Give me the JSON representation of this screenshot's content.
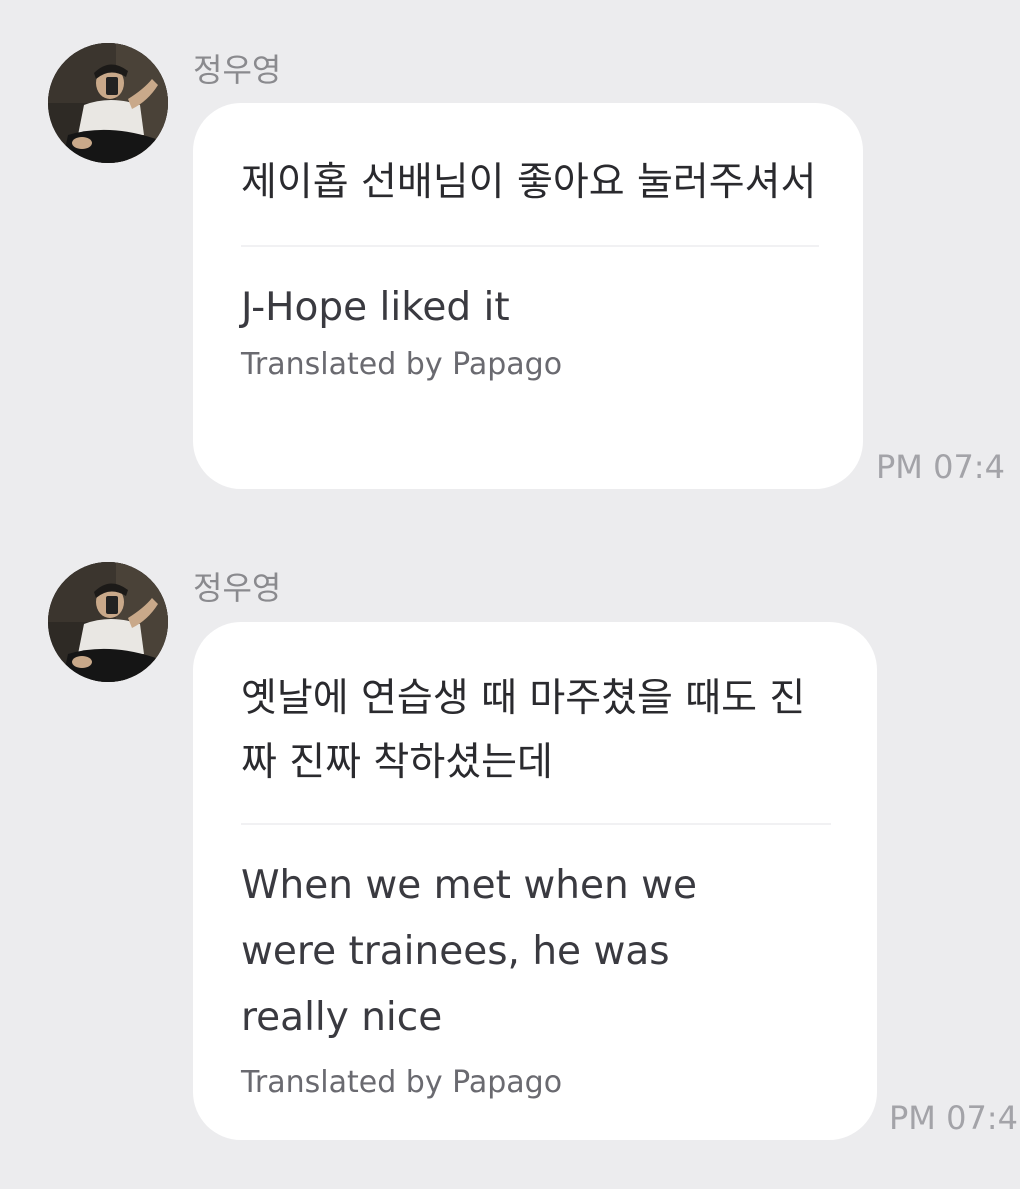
{
  "messages": [
    {
      "sender": "정우영",
      "original": "제이홉 선배님이 좋아요 눌러주셔서",
      "translation": "J-Hope liked it",
      "credit": "Translated by Papago",
      "time": "PM 07:4"
    },
    {
      "sender": "정우영",
      "original": "옛날에 연습생 때 마주쳤을 때도 진짜 진짜 착하셨는데",
      "translation": "When we met when we were trainees, he was really nice",
      "credit": "Translated by Papago",
      "time": "PM 07:4"
    }
  ],
  "colors": {
    "background": "#ececee",
    "bubble": "#ffffff",
    "sender_text": "#8a8a8e",
    "time_text": "#a3a3a8"
  },
  "icons": {
    "avatar": "profile-photo"
  }
}
